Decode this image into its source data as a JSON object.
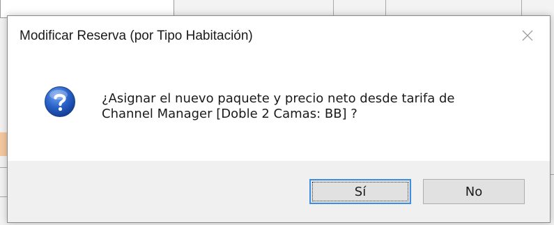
{
  "dialog": {
    "title": "Modificar Reserva (por Tipo Habitación)",
    "message": "¿Asignar el nuevo paquete y precio neto desde tarifa de\nChannel Manager [Doble 2 Camas: BB] ?",
    "icon": "question-icon",
    "close_icon": "close-icon",
    "buttons": {
      "yes_label": "Sí",
      "no_label": "No"
    }
  },
  "colors": {
    "focus_border": "#3c8ee0",
    "icon_blue": "#1f56c0"
  }
}
